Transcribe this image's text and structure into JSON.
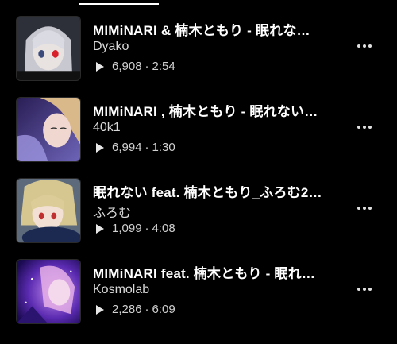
{
  "tracks": [
    {
      "title": "MIMiNARI & 楠木ともり - 眠れな…",
      "artist": "Dyako",
      "plays": "6,908",
      "duration": "2:54",
      "thumb_colors": [
        "#3a3d48",
        "#c9cad3",
        "#0e0e12"
      ]
    },
    {
      "title": "MIMiNARI , 楠木ともり - 眠れない…",
      "artist": "40k1_",
      "plays": "6,994",
      "duration": "1:30",
      "thumb_colors": [
        "#2c2560",
        "#8a7fcf",
        "#e8cfa9"
      ]
    },
    {
      "title": "眠れない feat. 楠木ともり_ふろむ2…",
      "artist": "ふろむ",
      "plays": "1,099",
      "duration": "4:08",
      "thumb_colors": [
        "#4b5a6e",
        "#d8c89a",
        "#1c2a50"
      ]
    },
    {
      "title": "MIMiNARI feat. 楠木ともり - 眠れ…",
      "artist": "Kosmolab",
      "plays": "2,286",
      "duration": "6:09",
      "thumb_colors": [
        "#3a1a8a",
        "#d8a0e8",
        "#8a4cd8"
      ]
    }
  ],
  "separator": "·",
  "icons": {
    "play": "play-icon",
    "more": "more-options-icon"
  }
}
